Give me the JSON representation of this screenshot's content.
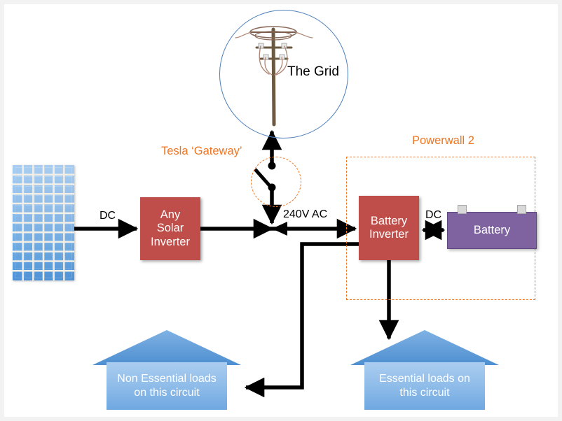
{
  "diagram": {
    "title": "Tesla Powerwall 2 system wiring diagram",
    "colors": {
      "inverter_red": "#bf4e4a",
      "battery_purple": "#7f63a1",
      "panel_blue": "#8dbbe8",
      "house_blue": "#8fbce9",
      "accent_orange": "#ef7521",
      "grid_circle_blue": "#4a7ebb",
      "wire_black": "#000000",
      "canvas_background": "#ffffff",
      "page_background": "#f2f2f2"
    }
  },
  "nodes": {
    "grid": {
      "label": "The Grid",
      "icon": "utility-power-pole-icon"
    },
    "solar_panel": {
      "icon": "solar-panel-icon",
      "columns": 6,
      "rows": 12
    },
    "solar_inverter": {
      "label": "Any Solar Inverter",
      "lines": [
        "Any",
        "Solar",
        "Inverter"
      ]
    },
    "battery_inverter": {
      "label": "Battery Inverter",
      "lines": [
        "Battery",
        "Inverter"
      ]
    },
    "battery": {
      "label": "Battery"
    },
    "house_non_essential": {
      "label": "Non Essential loads on this circuit",
      "lines": [
        "Non Essential loads",
        "on this circuit"
      ]
    },
    "house_essential": {
      "label": "Essential loads on this circuit",
      "lines": [
        "Essential loads on",
        "this circuit"
      ]
    }
  },
  "groups": {
    "gateway": {
      "label": "Tesla ‘Gateway’",
      "icon": "open-switch-icon"
    },
    "powerwall": {
      "label": "Powerwall 2"
    }
  },
  "edge_labels": {
    "dc_solar": "DC",
    "ac_main": "240V AC",
    "dc_battery": "DC"
  }
}
